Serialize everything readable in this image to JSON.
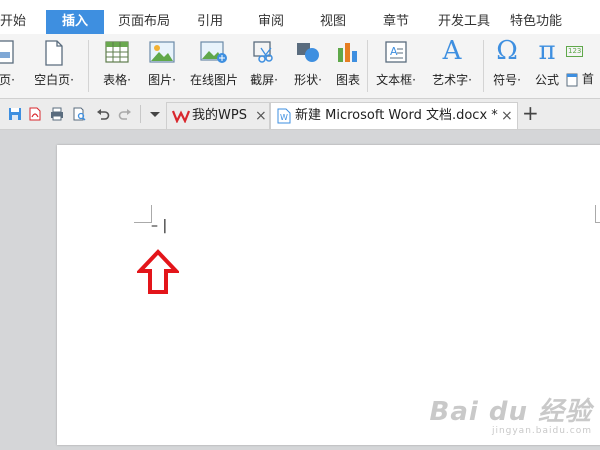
{
  "menu": {
    "tabs": [
      {
        "label": "开始",
        "active": false
      },
      {
        "label": "插入",
        "active": true
      },
      {
        "label": "页面布局",
        "active": false
      },
      {
        "label": "引用",
        "active": false
      },
      {
        "label": "审阅",
        "active": false
      },
      {
        "label": "视图",
        "active": false
      },
      {
        "label": "章节",
        "active": false
      },
      {
        "label": "开发工具",
        "active": false
      },
      {
        "label": "特色功能",
        "active": false
      }
    ]
  },
  "ribbon": {
    "items": [
      {
        "label": "页·",
        "icon": "cover-page-icon"
      },
      {
        "label": "空白页·",
        "icon": "blank-page-icon"
      },
      {
        "label": "表格·",
        "icon": "table-icon"
      },
      {
        "label": "图片·",
        "icon": "picture-icon"
      },
      {
        "label": "在线图片",
        "icon": "online-picture-icon"
      },
      {
        "label": "截屏·",
        "icon": "screenshot-icon"
      },
      {
        "label": "形状·",
        "icon": "shapes-icon"
      },
      {
        "label": "图表",
        "icon": "chart-icon"
      },
      {
        "label": "文本框·",
        "icon": "textbox-icon"
      },
      {
        "label": "艺术字·",
        "icon": "wordart-icon"
      },
      {
        "label": "符号·",
        "icon": "symbol-icon"
      },
      {
        "label": "公式",
        "icon": "formula-icon"
      },
      {
        "label": "首",
        "icon": "header-icon"
      }
    ],
    "symbol_glyph": "Ω",
    "formula_glyph": "π",
    "wordart_glyph": "A",
    "small_badge": "123"
  },
  "quick_access": {
    "icons": [
      "save-icon",
      "export-pdf-icon",
      "print-icon",
      "print-preview-icon",
      "undo-icon",
      "redo-icon",
      "dropdown-icon"
    ]
  },
  "tabs": {
    "home_tab": {
      "label": "我的WPS",
      "close": "×"
    },
    "doc_tab": {
      "label": "新建 Microsoft Word 文档.docx *",
      "close": "×"
    },
    "add": "+"
  },
  "document": {
    "cursor_text": "– |"
  },
  "watermark": {
    "main": "Bai du 经验",
    "sub": "jingyan.baidu.com"
  },
  "colors": {
    "accent": "#3e8fe0",
    "arrow": "#e3151a",
    "wps_red": "#d9272d"
  }
}
